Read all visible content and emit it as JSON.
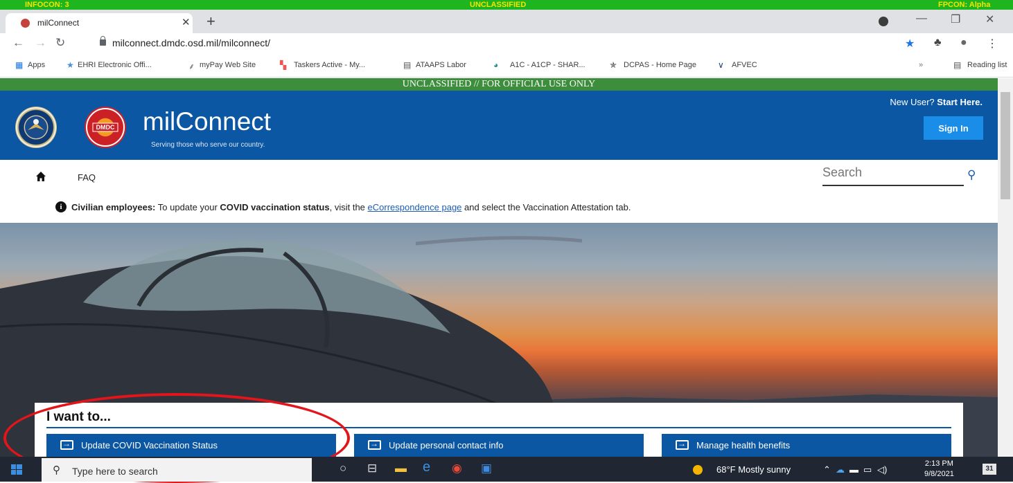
{
  "classification_bar": {
    "left": "INFOCON: 3",
    "center": "UNCLASSIFIED",
    "right": "FPCON: Alpha"
  },
  "browser": {
    "tab_title": "milConnect",
    "url": "milconnect.dmdc.osd.mil/milconnect/",
    "bookmarks": [
      {
        "label": "Apps",
        "icon": "apps-grid-icon"
      },
      {
        "label": "EHRI Electronic Offi...",
        "icon": "star-icon"
      },
      {
        "label": "myPay Web Site",
        "icon": "pay-icon"
      },
      {
        "label": "Taskers Active - My...",
        "icon": "windows-logo-icon"
      },
      {
        "label": "ATAAPS Labor",
        "icon": "page-icon"
      },
      {
        "label": "A1C - A1CP - SHAR...",
        "icon": "sharepoint-icon"
      },
      {
        "label": "DCPAS - Home Page",
        "icon": "star-emblem-icon"
      },
      {
        "label": "AFVEC",
        "icon": "afvec-icon"
      }
    ],
    "more_bookmarks": "»",
    "reading_list": "Reading list"
  },
  "site": {
    "banner": "UNCLASSIFIED // FOR OFFICIAL USE ONLY",
    "seal_text": "DMDC",
    "brand": "milConnect",
    "tagline": "Serving those who serve our country.",
    "new_user_prefix": "New User? ",
    "new_user_link": "Start Here.",
    "sign_in": "Sign In",
    "nav": {
      "faq": "FAQ",
      "search_placeholder": "Search"
    },
    "notice": {
      "lead": "Civilian employees:",
      "part1": " To update your ",
      "bold": "COVID vaccination status",
      "part2": ", visit the ",
      "link": "eCorrespondence page",
      "part3": " and select the Vaccination Attestation tab."
    },
    "panel": {
      "heading": "I want to...",
      "actions": [
        "Update COVID Vaccination Status",
        "Update personal contact info",
        "Manage health benefits"
      ]
    }
  },
  "taskbar": {
    "search_text": "Type here to search",
    "weather": "68°F  Mostly sunny",
    "time": "2:13 PM",
    "date": "9/8/2021",
    "notifications": "31"
  },
  "colors": {
    "header_blue": "#0b57a4",
    "sign_in_blue": "#1a8de8",
    "annotation_red": "#e2151b",
    "classification_green": "#1fb51f"
  }
}
